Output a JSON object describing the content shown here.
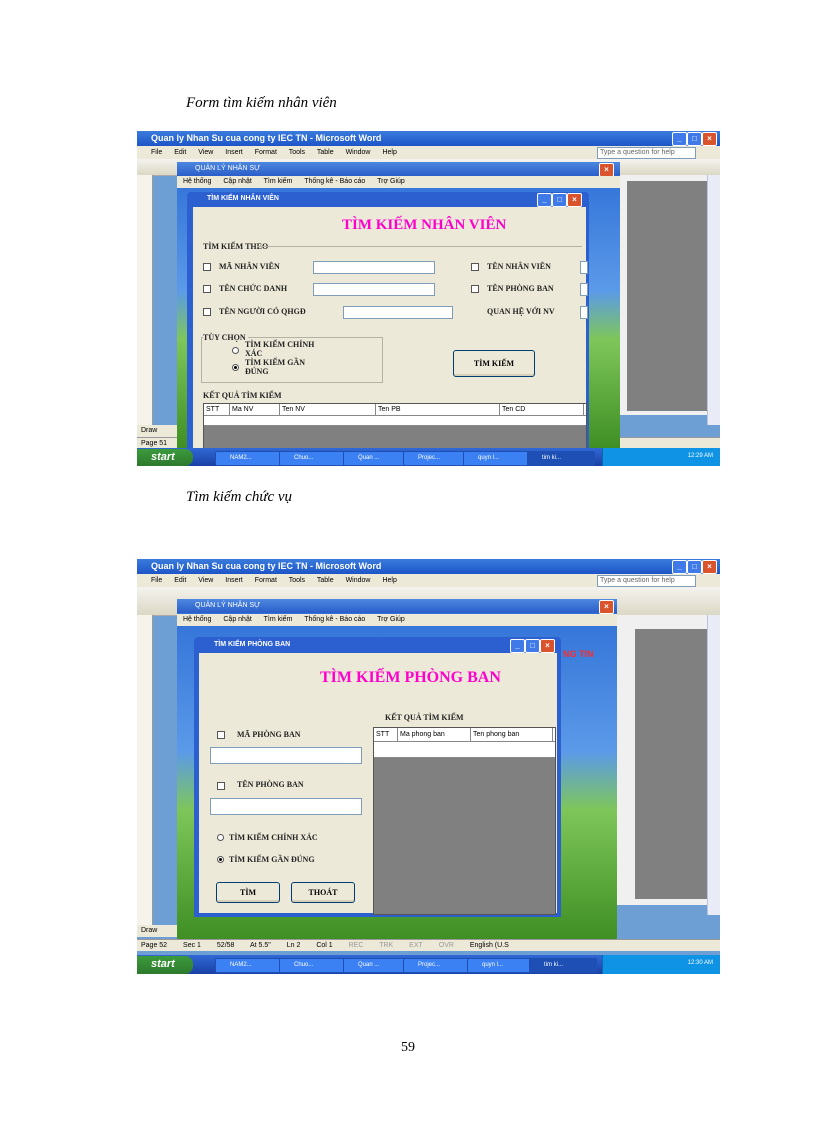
{
  "captions": {
    "first": "Form tìm kiếm nhân viên",
    "second": "Tìm kiếm chức vụ"
  },
  "page_number": "59",
  "shot1": {
    "word_title": "Quan ly Nhan Su cua cong ty IEC TN - Microsoft Word",
    "word_menu": [
      "File",
      "Edit",
      "View",
      "Insert",
      "Format",
      "Tools",
      "Table",
      "Window",
      "Help"
    ],
    "help_placeholder": "Type a question for help",
    "mdi_title": "QUẢN LÝ NHÂN SỰ",
    "app_menu": [
      "Hệ thống",
      "Cập nhật",
      "Tìm kiếm",
      "Thống kê - Báo cáo",
      "Trợ Giúp"
    ],
    "dialog_title": "TÌM KIẾM NHÂN VIÊN",
    "form_title": "TÌM KIẾM NHÂN VIÊN",
    "search_group": "TÌM KIẾM THEO",
    "fields": {
      "ma_nv": "MÃ NHÂN VIÊN",
      "ten_chuc_danh": "TÊN CHỨC DANH",
      "ten_nguoi_qhgd": "TÊN NGƯỜI CÓ QHGĐ",
      "ten_nv": "TÊN NHÂN VIÊN",
      "ten_pb": "TÊN PHÒNG BAN",
      "quan_he": "QUAN HỆ VỚI NV"
    },
    "options_group": "TÙY CHỌN",
    "option_exact": "TÌM KIẾM CHÍNH XÁC",
    "option_near": "TÌM KIẾM GẦN ĐÚNG",
    "search_button": "TÌM KIẾM",
    "results_label": "KẾT QUẢ TÌM KIẾM",
    "columns": [
      "STT",
      "Ma NV",
      "Ten NV",
      "Ten PB",
      "Ten CD"
    ],
    "word_status": [
      "Page 51"
    ],
    "side_label": "Draw",
    "start": "start",
    "taskbar_items": [
      "NAM2...",
      "Chuo...",
      "Quan ...",
      "Projec...",
      "quyn l...",
      "tim ki..."
    ],
    "clock": "12:29 AM"
  },
  "shot2": {
    "word_title": "Quan ly Nhan Su cua cong ty IEC TN - Microsoft Word",
    "word_menu": [
      "File",
      "Edit",
      "View",
      "Insert",
      "Format",
      "Tools",
      "Table",
      "Window",
      "Help"
    ],
    "help_placeholder": "Type a question for help",
    "mdi_title": "QUẢN LÝ NHÂN SỰ",
    "app_menu": [
      "Hệ thống",
      "Cập nhật",
      "Tìm kiếm",
      "Thống kê - Báo cáo",
      "Trợ Giúp"
    ],
    "dialog_title": "TÌM KIẾM PHÒNG BAN",
    "form_title": "TÌM KIẾM PHÒNG BAN",
    "behind_text": "NG TIN",
    "field_ma": "MÃ PHÒNG BAN",
    "field_ten": "TÊN PHÒNG BAN",
    "option_exact": "TÌM KIẾM CHÍNH XÁC",
    "option_near": "TÌM KIẾM GẦN ĐÚNG",
    "button_search": "TÌM",
    "button_exit": "THOÁT",
    "results_label": "KẾT QUẢ TÌM KIẾM",
    "columns": [
      "STT",
      "Ma phong ban",
      "Ten phong ban"
    ],
    "word_status": [
      "Page 52",
      "Sec 1",
      "52/58",
      "At 5.5\"",
      "Ln 2",
      "Col 1",
      "REC",
      "TRK",
      "EXT",
      "OVR",
      "English (U.S"
    ],
    "side_label": "Draw",
    "start": "start",
    "taskbar_items": [
      "NAM2...",
      "Chuo...",
      "Quan ...",
      "Projec...",
      "quyn l...",
      "tim ki..."
    ],
    "clock": "12:30 AM"
  }
}
